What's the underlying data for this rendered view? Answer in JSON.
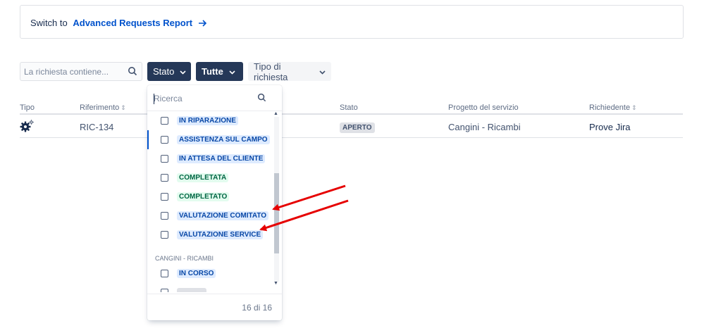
{
  "banner": {
    "prefix": "Switch to",
    "link": "Advanced Requests Report"
  },
  "filters": {
    "search_placeholder": "La richiesta contiene...",
    "status_button": "Stato",
    "all_button": "Tutte",
    "type_button": "Tipo di richiesta"
  },
  "table": {
    "headers": {
      "type": "Tipo",
      "reference": "Riferimento",
      "status": "Stato",
      "project": "Progetto del servizio",
      "requester": "Richiedente"
    },
    "rows": [
      {
        "type_icon": "gear-icon",
        "reference": "RIC-134",
        "status": "APERTO",
        "project": "Cangini - Ricambi",
        "requester": "Prove Jira"
      }
    ]
  },
  "dropdown": {
    "search_placeholder": "Ricerca",
    "items": [
      {
        "label": "IN RIPARAZIONE",
        "color": "blue"
      },
      {
        "label": "ASSISTENZA SUL CAMPO",
        "color": "blue"
      },
      {
        "label": "IN ATTESA DEL CLIENTE",
        "color": "blue"
      },
      {
        "label": "COMPLETATA",
        "color": "green"
      },
      {
        "label": "COMPLETATO",
        "color": "green"
      },
      {
        "label": "VALUTAZIONE COMITATO",
        "color": "blue"
      },
      {
        "label": "VALUTAZIONE SERVICE",
        "color": "blue"
      }
    ],
    "group_label": "CANGINI - RICAMBI",
    "group_items": [
      {
        "label": "IN CORSO",
        "color": "blue"
      }
    ],
    "count": "16 di 16"
  },
  "colors": {
    "dark_button": "#253858",
    "link": "#0052cc",
    "annotation_arrow": "#e60000"
  }
}
